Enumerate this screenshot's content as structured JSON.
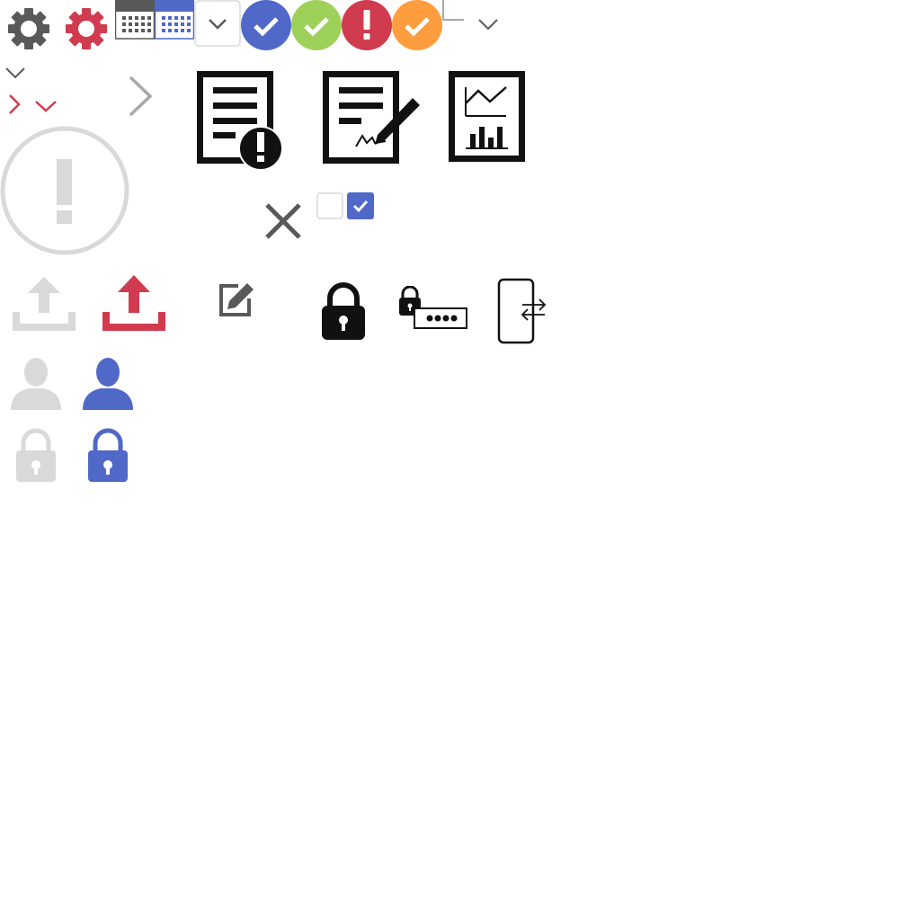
{
  "sprite": {
    "icons": [
      "gear-icon",
      "gear-active-icon",
      "calendar-icon",
      "calendar-active-icon",
      "dropdown-chevron-button",
      "status-check-blue-icon",
      "status-check-green-icon",
      "status-alert-red-icon",
      "status-check-orange-icon",
      "corner-bracket-icon",
      "chevron-down-icon",
      "chevron-down-small-icon",
      "chevron-right-red-icon",
      "chevron-down-red-icon",
      "chevron-right-large-icon",
      "alert-circle-icon",
      "document-alert-icon",
      "document-sign-icon",
      "document-report-icon",
      "close-icon",
      "checkbox-unchecked",
      "checkbox-checked",
      "upload-icon",
      "upload-active-icon",
      "edit-icon",
      "lock-icon",
      "password-lock-icon",
      "phone-transfer-icon",
      "user-icon",
      "user-active-icon",
      "lock-small-icon",
      "lock-small-active-icon"
    ]
  },
  "colors": {
    "dark_gray": "#595959",
    "red": "#d13b4f",
    "blue": "#5068c8",
    "green": "#9ed15a",
    "orange": "#ff9d3e",
    "light_gray": "#d9d9d9",
    "mid_gray": "#a8a8a8",
    "black": "#111111"
  }
}
